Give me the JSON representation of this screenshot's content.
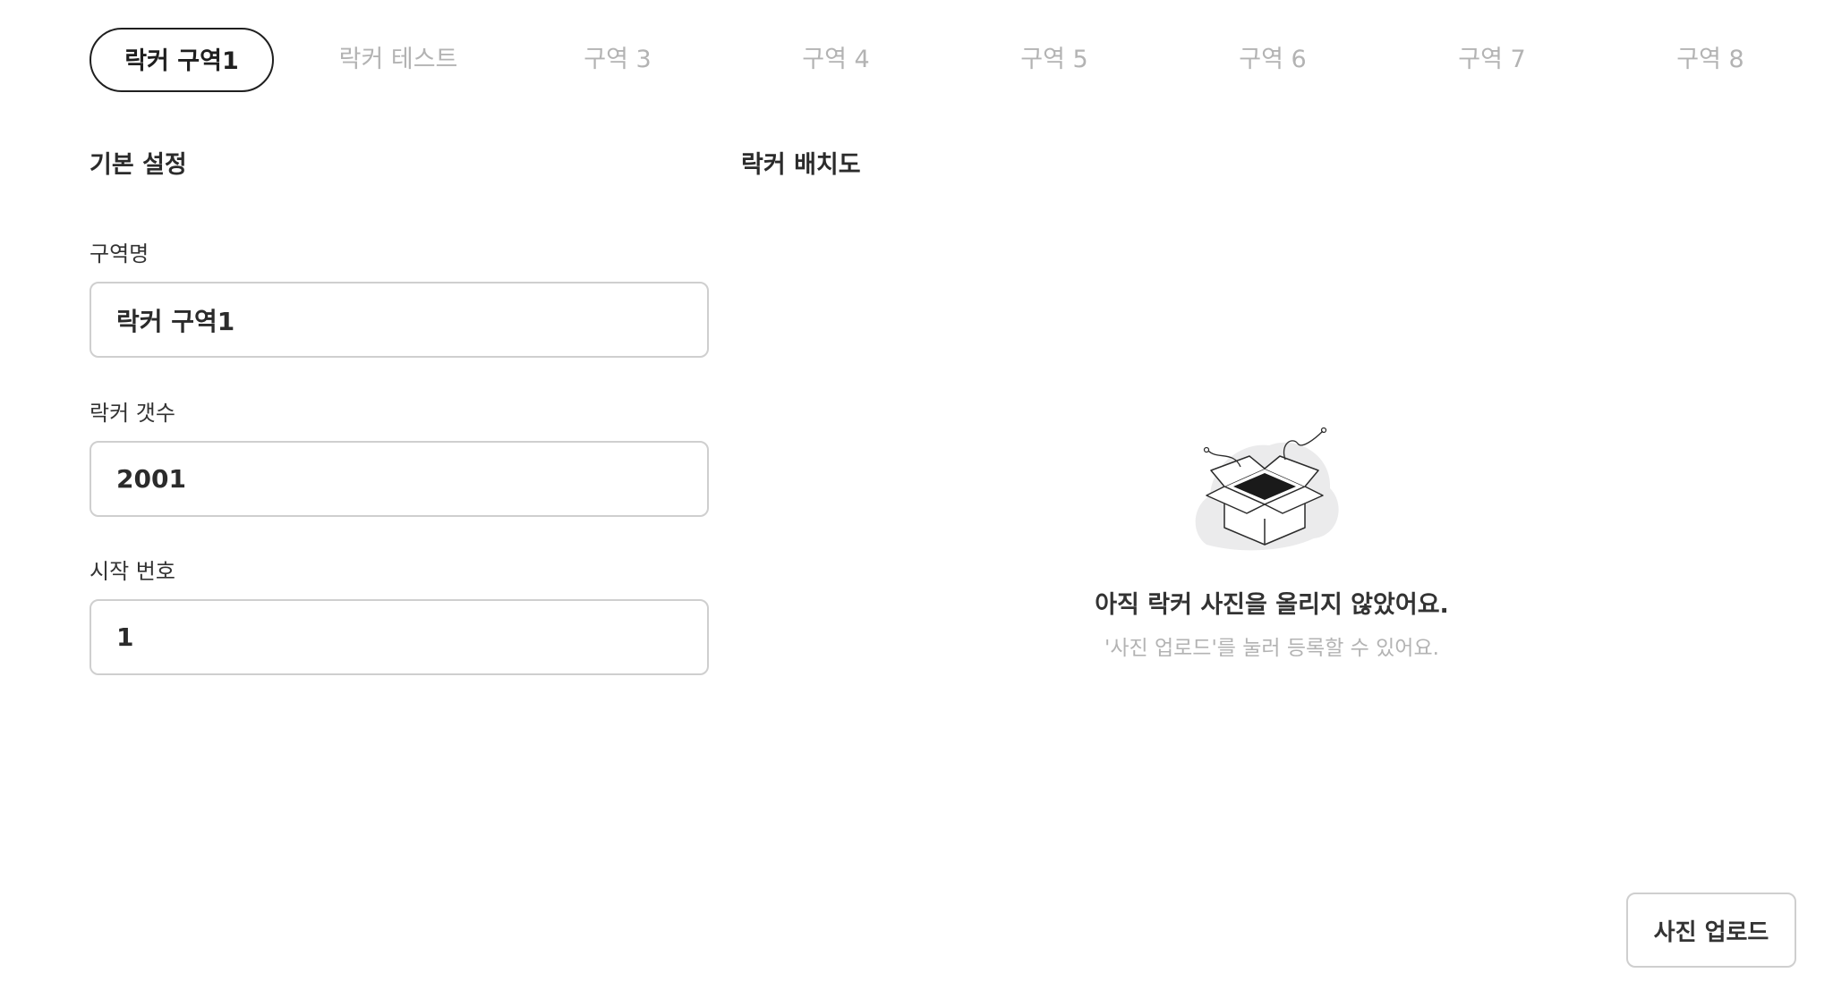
{
  "tabs": [
    {
      "label": "락커 구역1",
      "active": true
    },
    {
      "label": "락커 테스트",
      "active": false
    },
    {
      "label": "구역 3",
      "active": false
    },
    {
      "label": "구역 4",
      "active": false
    },
    {
      "label": "구역 5",
      "active": false
    },
    {
      "label": "구역 6",
      "active": false
    },
    {
      "label": "구역 7",
      "active": false
    },
    {
      "label": "구역 8",
      "active": false
    }
  ],
  "basic_settings": {
    "title": "기본 설정",
    "zone_name": {
      "label": "구역명",
      "value": "락커 구역1"
    },
    "locker_count": {
      "label": "락커 갯수",
      "value": "2001"
    },
    "start_number": {
      "label": "시작 번호",
      "value": "1"
    }
  },
  "layout_map": {
    "title": "락커 배치도",
    "empty_icon": "open-box-icon",
    "empty_title": "아직 락커 사진을 올리지 않았어요.",
    "empty_subtitle": "'사진 업로드'를 눌러 등록할 수 있어요."
  },
  "upload_button_label": "사진 업로드",
  "colors": {
    "active_tab_border": "#1f1f1f",
    "inactive_tab_text": "#b3b3b3",
    "input_border": "#cfcfcf",
    "illustration_blob": "#ebebec"
  }
}
